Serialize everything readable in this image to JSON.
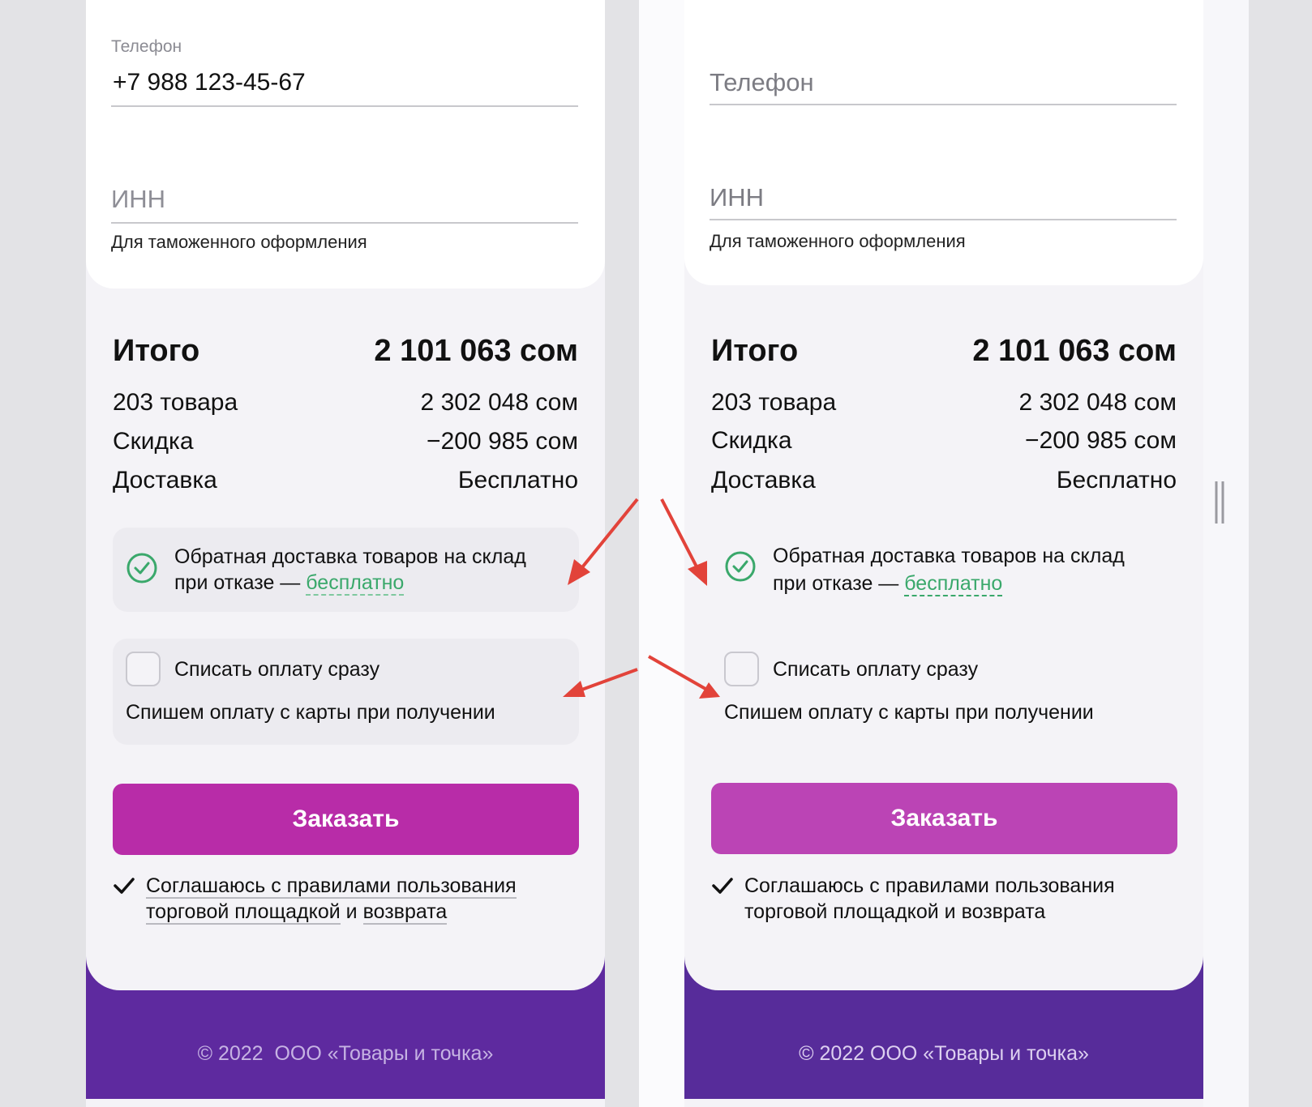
{
  "colors": {
    "page_bg": "#e3e3e6",
    "left_footer": "#5e2a9f",
    "right_footer": "#572c9a",
    "left_button": "#b82ca8",
    "right_button": "#bb44b5",
    "accent_green": "#3aa86b",
    "annotation_arrow": "#e2433a"
  },
  "left": {
    "phone_label": "Телефон",
    "phone_value": "+7 988 123-45-67",
    "inn_placeholder": "ИНН",
    "inn_hint": "Для таможенного оформления",
    "total_label": "Итого",
    "total_value": "2 101 063 сом",
    "items_label": "203 товара",
    "items_value": "2 302 048 сом",
    "discount_label": "Скидка",
    "discount_value": "−200 985 сом",
    "delivery_label": "Доставка",
    "delivery_value": "Бесплатно",
    "return_line1": "Обратная доставка товаров на склад",
    "return_line2_prefix": "при отказе — ",
    "return_link": "бесплатно",
    "pay_now_label": "Списать оплату сразу",
    "pay_hint": "Спишем оплату с карты при получении",
    "order_button": "Заказать",
    "agree_line1": "Соглашаюсь с правилами пользования",
    "agree_link1": "торговой площадкой",
    "agree_and": " и ",
    "agree_link2": "возврата",
    "footer": "© 2022  ООО «Товары и точка»"
  },
  "right": {
    "phone_placeholder": "Телефон",
    "inn_placeholder": "ИНН",
    "inn_hint": "Для таможенного оформления",
    "total_label": "Итого",
    "total_value": "2 101 063 сом",
    "items_label": "203 товара",
    "items_value": "2 302 048 сом",
    "discount_label": "Скидка",
    "discount_value": "−200 985 сом",
    "delivery_label": "Доставка",
    "delivery_value": "Бесплатно",
    "return_line1": "Обратная доставка товаров на склад",
    "return_line2_prefix": "при отказе — ",
    "return_link": "бесплатно",
    "pay_now_label": "Списать оплату сразу",
    "pay_hint": "Спишем оплату с карты при получении",
    "order_button": "Заказать",
    "agree_line1": "Соглашаюсь с правилами пользования",
    "agree_line2": "торговой площадкой и возврата",
    "footer": "© 2022 ООО «Товары и точка»"
  }
}
